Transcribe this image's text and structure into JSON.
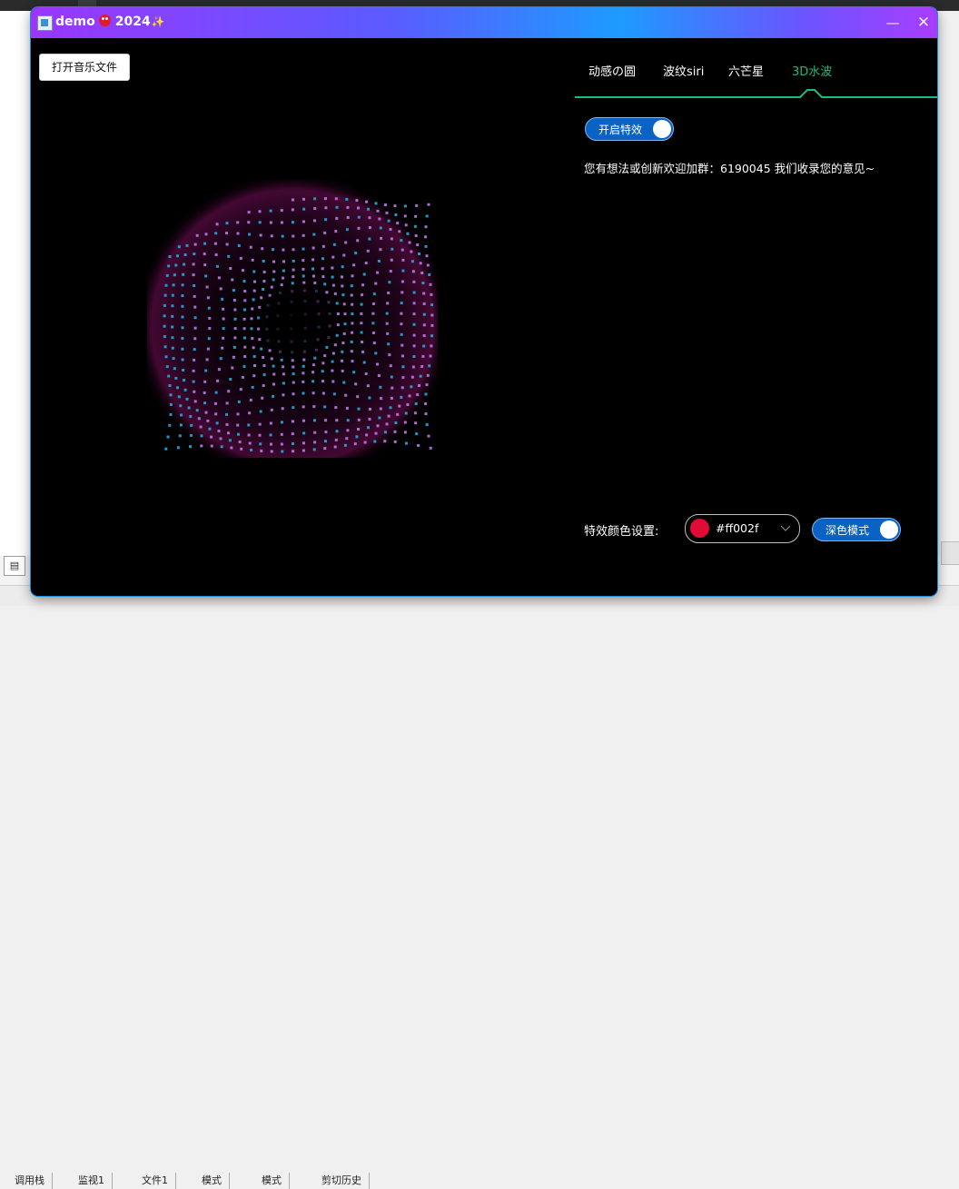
{
  "window": {
    "title": "demo",
    "title_year": "2024",
    "title_spark": "✨",
    "minimize_glyph": "—",
    "close_glyph": "✕"
  },
  "toolbar": {
    "open_file_label": "打开音乐文件"
  },
  "tabs": [
    {
      "label": "动感の圆",
      "active": false
    },
    {
      "label": "波纹siri",
      "active": false
    },
    {
      "label": "六芒星",
      "active": false
    },
    {
      "label": "3D水波",
      "active": true
    }
  ],
  "effects": {
    "toggle_label": "开启特效",
    "toggle_on": true,
    "notice": "您有想法或创新欢迎加群：6190045 我们收录您的意见~"
  },
  "color_settings": {
    "label": "特效颜色设置:",
    "selected_value": "#ff002f",
    "swatch_color": "#e20a36"
  },
  "dark_mode": {
    "label": "深色模式",
    "on": true
  },
  "colors": {
    "accent_green": "#1fb97a",
    "toggle_blue": "#0a62c4",
    "viz_cyan": "#27a7d8",
    "viz_violet": "#b77ae8",
    "viz_glow": "#7a0f5c"
  },
  "background_taskbar": {
    "items": [
      "调用栈",
      "监视1",
      "文件1",
      "模式",
      "模式",
      "剪切历史"
    ]
  }
}
